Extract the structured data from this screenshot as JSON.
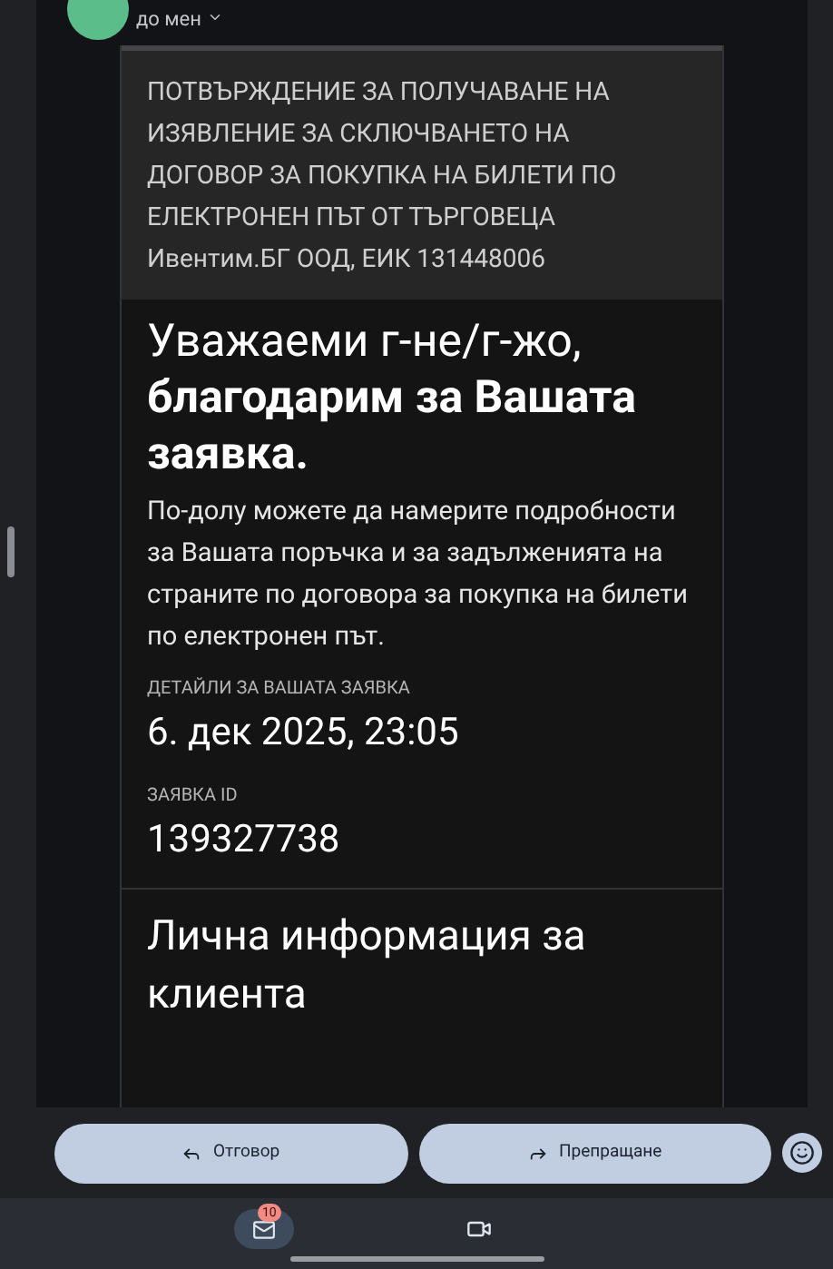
{
  "sender": {
    "to_label": "до мен"
  },
  "email": {
    "header": "ПОТВЪРЖДЕНИЕ ЗА ПОЛУЧАВАНЕ НА ИЗЯВЛЕНИЕ ЗА СКЛЮЧВАНЕТО НА ДОГОВОР ЗА ПОКУПКА НА БИЛЕТИ ПО ЕЛЕКТРОНЕН ПЪТ ОТ ТЪРГОВЕЦА Ивентим.БГ ООД, ЕИК 131448006",
    "greeting": "Уважаеми г-не/г-жо,",
    "thanks": "благодарим за Вашата заявка.",
    "intro": "По-долу можете да намерите подробности за Вашата поръчка и за задълженията на страните по договора за покупка на билети по електронен път.",
    "details_label": "ДЕТАЙЛИ ЗА ВАШАТА ЗАЯВКА",
    "date": "6. дек 2025, 23:05",
    "id_label": "ЗАЯВКА ID",
    "id": "139327738",
    "section_title": "Лична информация за клиента"
  },
  "actions": [
    {
      "kind": "reply",
      "label": "Отговор"
    },
    {
      "kind": "forward",
      "label": "Препращане"
    }
  ],
  "nav": {
    "badge": "10"
  }
}
